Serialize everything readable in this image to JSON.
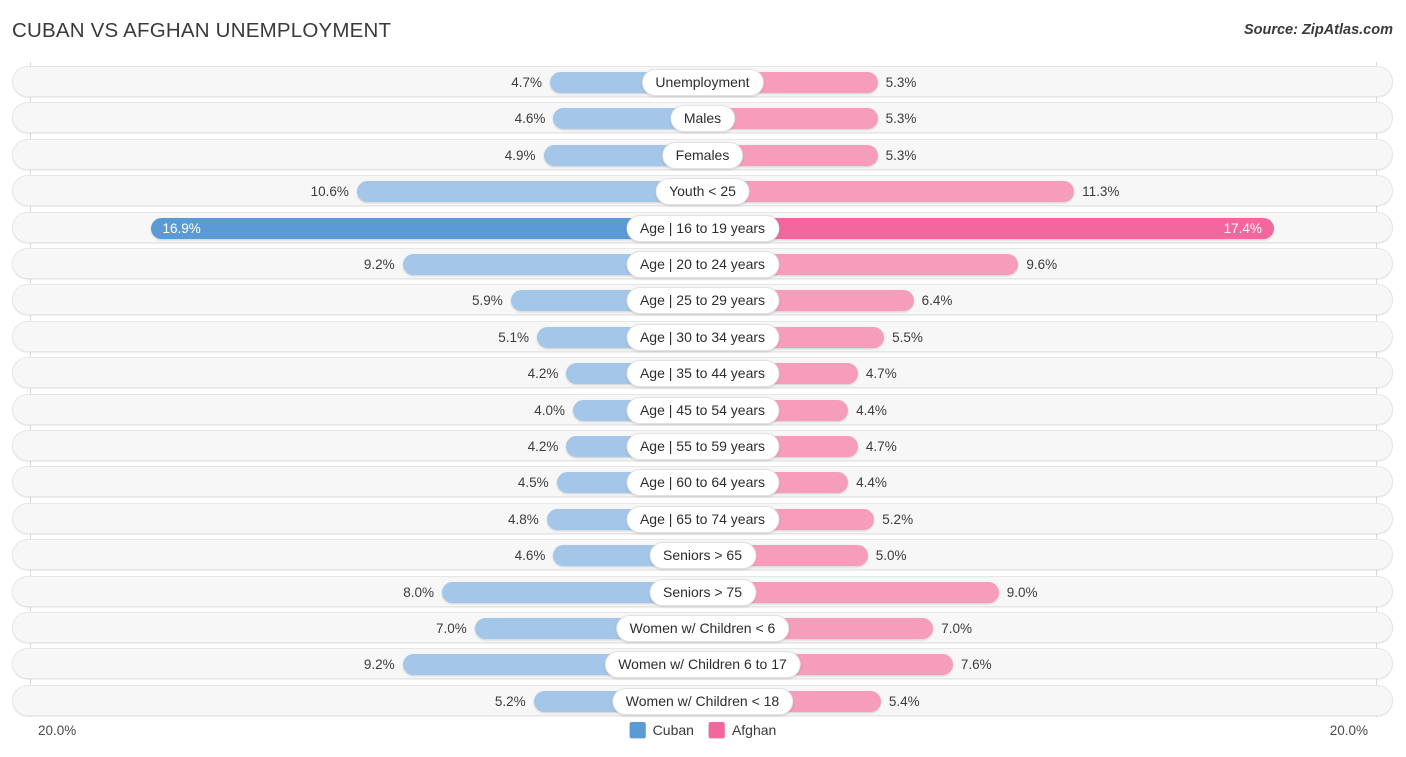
{
  "header": {
    "title": "CUBAN VS AFGHAN UNEMPLOYMENT",
    "source": "Source: ZipAtlas.com"
  },
  "axis": {
    "left_tick": "20.0%",
    "right_tick": "20.0%",
    "max": 20.0
  },
  "legend": {
    "items": [
      {
        "label": "Cuban",
        "color": "#5b9bd5"
      },
      {
        "label": "Afghan",
        "color": "#f4679e"
      }
    ]
  },
  "colors": {
    "cuban_light": "#a3c6e9",
    "afghan_light": "#f79dbc",
    "cuban_highlight": "#5b9bd5",
    "afghan_highlight": "#f4679e",
    "row_background": "#f7f7f7",
    "page_background": "#ffffff"
  },
  "chart_data": {
    "type": "bar",
    "title": "CUBAN VS AFGHAN UNEMPLOYMENT",
    "subtitle": "Source: ZipAtlas.com",
    "orientation": "horizontal-diverging",
    "xlabel": "",
    "ylabel": "",
    "xlim": [
      20.0,
      20.0
    ],
    "grid": false,
    "legend_position": "bottom-center",
    "categories": [
      "Unemployment",
      "Males",
      "Females",
      "Youth < 25",
      "Age | 16 to 19 years",
      "Age | 20 to 24 years",
      "Age | 25 to 29 years",
      "Age | 30 to 34 years",
      "Age | 35 to 44 years",
      "Age | 45 to 54 years",
      "Age | 55 to 59 years",
      "Age | 60 to 64 years",
      "Age | 65 to 74 years",
      "Seniors > 65",
      "Seniors > 75",
      "Women w/ Children < 6",
      "Women w/ Children 6 to 17",
      "Women w/ Children < 18"
    ],
    "series": [
      {
        "name": "Cuban",
        "side": "left",
        "color": "#a3c6e9",
        "values": [
          4.7,
          4.6,
          4.9,
          10.6,
          16.9,
          9.2,
          5.9,
          5.1,
          4.2,
          4.0,
          4.2,
          4.5,
          4.8,
          4.6,
          8.0,
          7.0,
          9.2,
          5.2
        ],
        "labels": [
          "4.7%",
          "4.6%",
          "4.9%",
          "10.6%",
          "16.9%",
          "9.2%",
          "5.9%",
          "5.1%",
          "4.2%",
          "4.0%",
          "4.2%",
          "4.5%",
          "4.8%",
          "4.6%",
          "8.0%",
          "7.0%",
          "9.2%",
          "5.2%"
        ]
      },
      {
        "name": "Afghan",
        "side": "right",
        "color": "#f79dbc",
        "values": [
          5.3,
          5.3,
          5.3,
          11.3,
          17.4,
          9.6,
          6.4,
          5.5,
          4.7,
          4.4,
          4.7,
          4.4,
          5.2,
          5.0,
          9.0,
          7.0,
          7.6,
          5.4
        ],
        "labels": [
          "5.3%",
          "5.3%",
          "5.3%",
          "11.3%",
          "17.4%",
          "9.6%",
          "6.4%",
          "5.5%",
          "4.7%",
          "4.4%",
          "4.7%",
          "4.4%",
          "5.2%",
          "5.0%",
          "9.0%",
          "7.0%",
          "7.6%",
          "5.4%"
        ]
      }
    ],
    "highlighted_row": 4
  },
  "rows": [
    {
      "label": "Unemployment",
      "left": "4.7%",
      "right": "5.3%",
      "lv": 4.7,
      "rv": 5.3,
      "hl": false
    },
    {
      "label": "Males",
      "left": "4.6%",
      "right": "5.3%",
      "lv": 4.6,
      "rv": 5.3,
      "hl": false
    },
    {
      "label": "Females",
      "left": "4.9%",
      "right": "5.3%",
      "lv": 4.9,
      "rv": 5.3,
      "hl": false
    },
    {
      "label": "Youth < 25",
      "left": "10.6%",
      "right": "11.3%",
      "lv": 10.6,
      "rv": 11.3,
      "hl": false
    },
    {
      "label": "Age | 16 to 19 years",
      "left": "16.9%",
      "right": "17.4%",
      "lv": 16.9,
      "rv": 17.4,
      "hl": true
    },
    {
      "label": "Age | 20 to 24 years",
      "left": "9.2%",
      "right": "9.6%",
      "lv": 9.2,
      "rv": 9.6,
      "hl": false
    },
    {
      "label": "Age | 25 to 29 years",
      "left": "5.9%",
      "right": "6.4%",
      "lv": 5.9,
      "rv": 6.4,
      "hl": false
    },
    {
      "label": "Age | 30 to 34 years",
      "left": "5.1%",
      "right": "5.5%",
      "lv": 5.1,
      "rv": 5.5,
      "hl": false
    },
    {
      "label": "Age | 35 to 44 years",
      "left": "4.2%",
      "right": "4.7%",
      "lv": 4.2,
      "rv": 4.7,
      "hl": false
    },
    {
      "label": "Age | 45 to 54 years",
      "left": "4.0%",
      "right": "4.4%",
      "lv": 4.0,
      "rv": 4.4,
      "hl": false
    },
    {
      "label": "Age | 55 to 59 years",
      "left": "4.2%",
      "right": "4.7%",
      "lv": 4.2,
      "rv": 4.7,
      "hl": false
    },
    {
      "label": "Age | 60 to 64 years",
      "left": "4.5%",
      "right": "4.4%",
      "lv": 4.5,
      "rv": 4.4,
      "hl": false
    },
    {
      "label": "Age | 65 to 74 years",
      "left": "4.8%",
      "right": "5.2%",
      "lv": 4.8,
      "rv": 5.2,
      "hl": false
    },
    {
      "label": "Seniors > 65",
      "left": "4.6%",
      "right": "5.0%",
      "lv": 4.6,
      "rv": 5.0,
      "hl": false
    },
    {
      "label": "Seniors > 75",
      "left": "8.0%",
      "right": "9.0%",
      "lv": 8.0,
      "rv": 9.0,
      "hl": false
    },
    {
      "label": "Women w/ Children < 6",
      "left": "7.0%",
      "right": "7.0%",
      "lv": 7.0,
      "rv": 7.0,
      "hl": false
    },
    {
      "label": "Women w/ Children 6 to 17",
      "left": "9.2%",
      "right": "7.6%",
      "lv": 9.2,
      "rv": 7.6,
      "hl": false
    },
    {
      "label": "Women w/ Children < 18",
      "left": "5.2%",
      "right": "5.4%",
      "lv": 5.2,
      "rv": 5.4,
      "hl": false
    }
  ]
}
